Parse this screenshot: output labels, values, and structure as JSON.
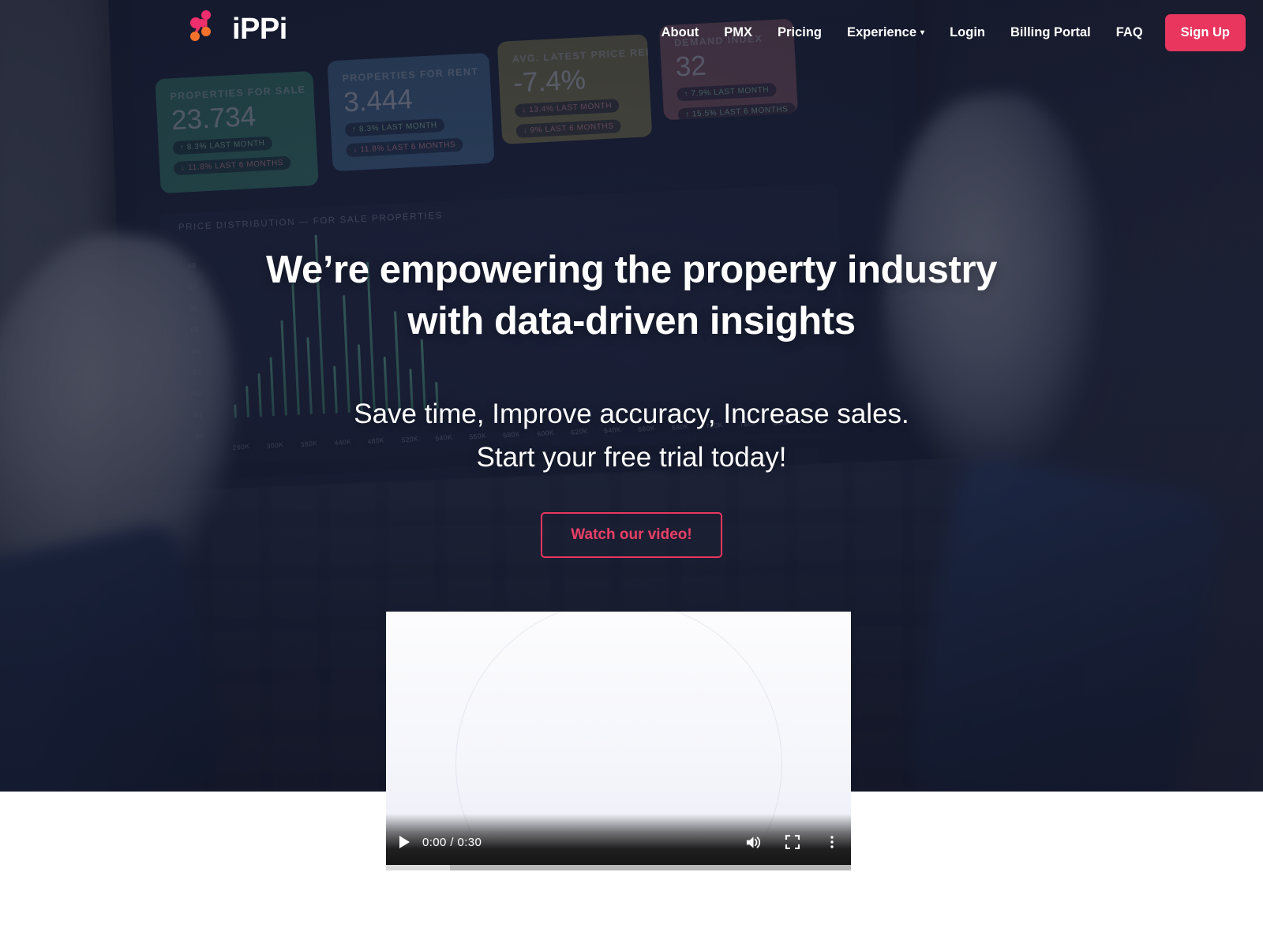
{
  "brand": {
    "name": "iPPi",
    "logo_icon": "network-nodes-icon"
  },
  "nav": {
    "links": [
      {
        "label": "About"
      },
      {
        "label": "PMX"
      },
      {
        "label": "Pricing"
      },
      {
        "label": "Experience",
        "caret": "▾"
      },
      {
        "label": "Login"
      },
      {
        "label": "Billing Portal"
      },
      {
        "label": "FAQ"
      }
    ],
    "signup_label": "Sign Up",
    "signup_color": "#e8365f"
  },
  "hero": {
    "headline_line1": "We’re empowering the property industry",
    "headline_line2": "with data-driven insights",
    "subhead_line1": "Save time, Improve accuracy, Increase sales.",
    "subhead_line2": "Start your free trial today!",
    "cta_label": "Watch our video!",
    "cta_color": "#e8365f"
  },
  "video": {
    "play_icon": "play-icon",
    "time_display": "0:00 / 0:30",
    "current_time": "0:00",
    "duration": "0:30",
    "mute_icon": "volume-icon",
    "fullscreen_icon": "fullscreen-icon",
    "more_icon": "more-options-icon"
  },
  "background_dashboard": {
    "cards": [
      {
        "title": "PROPERTIES FOR SALE",
        "value": "23.734",
        "chip_month": "↑ 8.3% LAST MONTH",
        "chip_six": "↓ 11.8% LAST 6 MONTHS",
        "color": "#3f9b7c"
      },
      {
        "title": "PROPERTIES FOR RENT",
        "value": "3.444",
        "chip_month": "↑ 8.3% LAST MONTH",
        "chip_six": "↓ 11.8% LAST 6 MONTHS",
        "color": "#4f7fa8"
      },
      {
        "title": "AVG. LATEST PRICE REMARK",
        "value": "-7.4%",
        "chip_month": "↓ 13.4% LAST MONTH",
        "chip_six": "↓ 9% LAST 6 MONTHS",
        "color": "#9d9359"
      },
      {
        "title": "DEMAND INDEX",
        "value": "32",
        "chip_month": "↑ 7.9% LAST MONTH",
        "chip_six": "↑ 15.5% LAST 6 MONTHS",
        "color": "#a46a72"
      }
    ],
    "chart_title": "PRICE DISTRIBUTION — FOR SALE PROPERTIES",
    "chart_title_2": "PRICE DISTRIBUTION — FOR SALE PROPERTIES",
    "chart2_tick": "10"
  },
  "chart_data": {
    "type": "bar",
    "title": "PRICE DISTRIBUTION — FOR SALE PROPERTIES",
    "xlabel": "",
    "ylabel": "",
    "categories": [
      "260K",
      "300K",
      "380K",
      "440K",
      "480K",
      "520K",
      "540K",
      "560K",
      "580K",
      "600K",
      "620K",
      "640K",
      "660K",
      "680K",
      "720K",
      "760K",
      "800K"
    ],
    "values": [
      0.6,
      1.4,
      1.9,
      2.6,
      4.2,
      5.8,
      3.4,
      7.9,
      2.1,
      5.2,
      3.0,
      6.6,
      2.4,
      4.4,
      1.8,
      3.1,
      1.2
    ],
    "ytick_labels": [
      "08",
      "07",
      "06",
      "05",
      "04",
      "03",
      "02",
      "01",
      "00"
    ],
    "ylim": [
      0,
      8
    ],
    "grid": false,
    "legend": null,
    "bar_color": "#5fc49a"
  }
}
